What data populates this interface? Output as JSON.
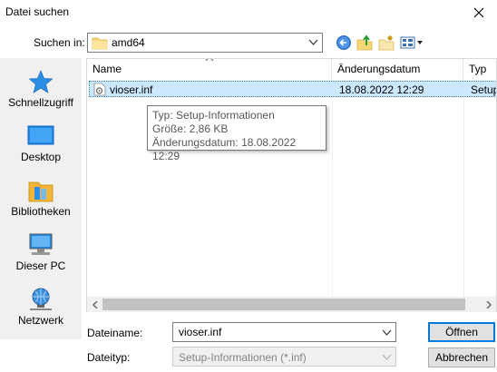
{
  "window": {
    "title": "Datei suchen"
  },
  "toolbar": {
    "look_in_label": "Suchen in:",
    "look_in_value": "amd64"
  },
  "places": [
    {
      "label": "Schnellzugriff",
      "icon": "star-icon"
    },
    {
      "label": "Desktop",
      "icon": "desktop-icon"
    },
    {
      "label": "Bibliotheken",
      "icon": "libraries-icon"
    },
    {
      "label": "Dieser PC",
      "icon": "computer-icon"
    },
    {
      "label": "Netzwerk",
      "icon": "network-icon"
    }
  ],
  "list": {
    "columns": [
      "Name",
      "Änderungsdatum",
      "Typ"
    ],
    "rows": [
      {
        "name": "vioser.inf",
        "date": "18.08.2022 12:29",
        "type": "Setup"
      }
    ]
  },
  "tooltip": {
    "type_line": "Typ: Setup-Informationen",
    "size_line": "Größe: 2,86 KB",
    "date_line": "Änderungsdatum: 18.08.2022 12:29"
  },
  "form": {
    "filename_label": "Dateiname:",
    "filename_value": "vioser.inf",
    "filetype_label": "Dateityp:",
    "filetype_value": "Setup-Informationen (*.inf)",
    "open_label": "Öffnen",
    "cancel_label": "Abbrechen"
  },
  "colors": {
    "selection": "#cce8ff",
    "accent": "#0078d7",
    "places_bg": "#f0f0f0"
  }
}
